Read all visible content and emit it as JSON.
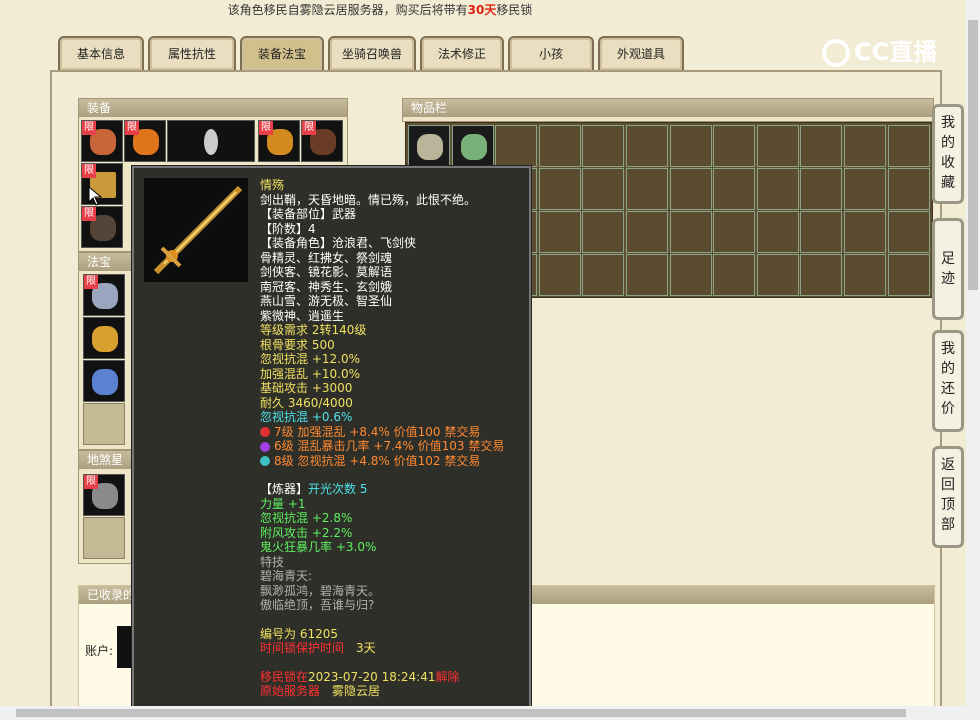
{
  "notice": {
    "prefix": "该角色移民自雾隐云居服务器，购买后将带有",
    "days": "30天",
    "suffix": "移民锁"
  },
  "tabs": [
    "基本信息",
    "属性抗性",
    "装备法宝",
    "坐骑召唤兽",
    "法术修正",
    "小孩",
    "外观道具"
  ],
  "active_tab": "装备法宝",
  "logo": {
    "text": "CC直播"
  },
  "panels": {
    "equip": "装备",
    "fabao": "法宝",
    "dishazhi": "地煞星",
    "collected": "已收录的",
    "items": "物品栏",
    "account_label": "账户:"
  },
  "limit_badge": "限",
  "side_buttons": [
    "我的收藏",
    "足迹",
    "我的还价",
    "返回顶部"
  ],
  "tooltip": {
    "name": "情殇",
    "desc": "剑出鞘，天昏地暗。情已殇，此恨不绝。",
    "part": "【装备部位】武器",
    "tier": "【阶数】4",
    "roles": [
      "【装备角色】沧浪君、飞剑侠",
      "骨精灵、红拂女、祭剑魂",
      "剑侠客、镜花影、莫解语",
      "南冠客、神秀生、玄剑娥",
      "燕山雪、游无极、智圣仙",
      "紫微神、逍遥生"
    ],
    "stats": [
      "等级需求 2转140级",
      "根骨要求 500",
      "忽视抗混 +12.0%",
      "加强混乱 +10.0%",
      "基础攻击 +3000",
      "耐久 3460/4000"
    ],
    "cyan": "忽视抗混 +0.6%",
    "gems": [
      {
        "text": "7级 加强混乱 +8.4% 价值100 禁交易",
        "color": "#e03030"
      },
      {
        "text": "6级 混乱暴击几率 +7.4% 价值103 禁交易",
        "color": "#a040e0"
      },
      {
        "text": "8级 忽视抗混 +4.8% 价值102 禁交易",
        "color": "#40c0c0"
      }
    ],
    "refine_label": "【炼器】",
    "refine_count": "开光次数 5",
    "refine_stats": [
      "力量 +1",
      "忽视抗混 +2.8%",
      "附风攻击 +2.2%",
      "鬼火狂暴几率 +3.0%"
    ],
    "skill_label": "特技",
    "skill_name": "碧海青天:",
    "skill_desc": [
      "飘渺孤鸿，碧海青天。",
      "傲临绝顶，吾谁与归?"
    ],
    "serial": "编号为 61205",
    "protect_label": "时间锁保护时间",
    "protect_value": "3天",
    "lock_prefix": "移民锁在",
    "lock_time": "2023-07-20 18:24:41",
    "lock_suffix": "解除",
    "origin_label": "原始服务器",
    "origin_value": "雾隐云居"
  }
}
